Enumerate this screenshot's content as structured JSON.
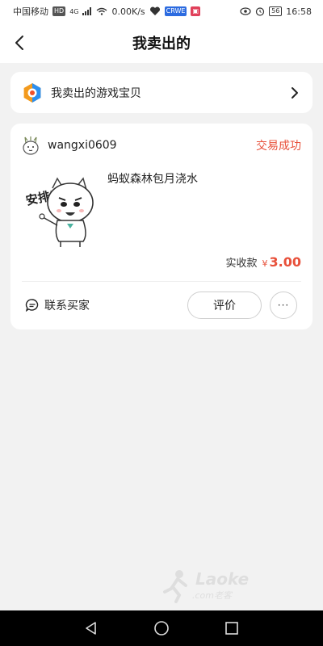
{
  "status_bar": {
    "carrier": "中国移动",
    "hd": "HD",
    "signal": "4G",
    "speed": "0.00K/s",
    "app_badge_1": "CRWE",
    "battery": "56",
    "time": "16:58"
  },
  "header": {
    "title": "我卖出的"
  },
  "games_entry": {
    "label": "我卖出的游戏宝贝"
  },
  "order": {
    "username": "wangxi0609",
    "status": "交易成功",
    "product_title": "蚂蚁森林包月浇水",
    "sticker_text": "安排!",
    "price_label": "实收款",
    "currency": "¥",
    "price": "3.00",
    "contact_label": "联系买家",
    "review_label": "评价",
    "more_label": "···"
  },
  "watermark": {
    "text": "Laoke",
    "sub": ".com老客"
  },
  "colors": {
    "accent": "#e8503a",
    "background": "#f2f2f2"
  }
}
